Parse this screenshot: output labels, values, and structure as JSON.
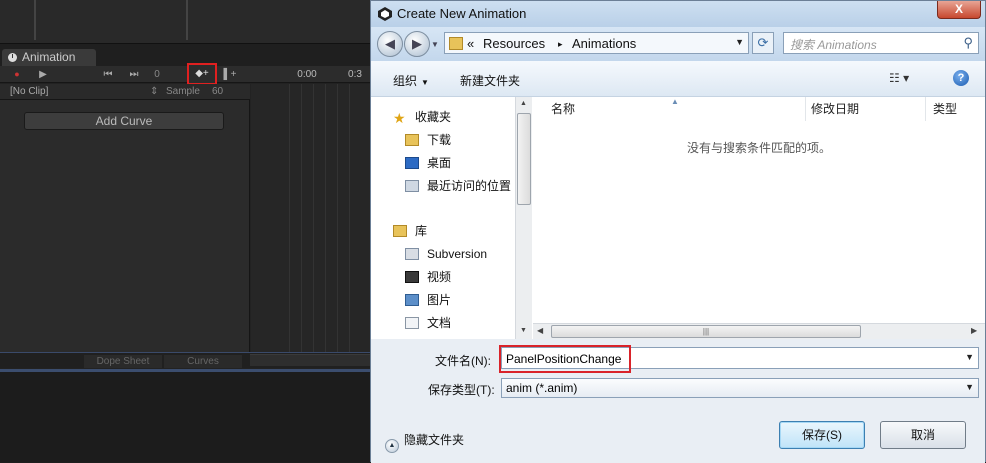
{
  "unity": {
    "tab_label": "Animation",
    "frame_value": "0",
    "time_start": "0:00",
    "time_next": "0:3",
    "clip_label": "[No Clip]",
    "clip_arrows": "⇕",
    "sample_label": "Sample",
    "sample_value": "60",
    "add_curve_label": "Add Curve",
    "dope_sheet_label": "Dope Sheet",
    "curves_label": "Curves",
    "record_glyph": "●",
    "play_glyph": "▶",
    "prev_glyph": "⏮",
    "next_glyph": "⏭",
    "add_key_glyph": "◆+",
    "add_event_glyph": "▌+"
  },
  "dialog": {
    "title": "Create New Animation",
    "close_glyph": "X",
    "address": {
      "sep": "«",
      "crumbs": [
        "Resources",
        "Animations"
      ],
      "arrow": "▸"
    },
    "search_placeholder": "搜索 Animations",
    "toolbar": {
      "organize": "组织",
      "new_folder": "新建文件夹",
      "help": "?"
    },
    "nav_items": [
      {
        "label": "收藏夹",
        "icon": "star-icon"
      },
      {
        "label": "下载",
        "icon": "download-folder-icon"
      },
      {
        "label": "桌面",
        "icon": "desktop-icon"
      },
      {
        "label": "最近访问的位置",
        "icon": "recent-places-icon"
      },
      {
        "label": "库",
        "icon": "library-icon"
      },
      {
        "label": "Subversion",
        "icon": "subversion-icon"
      },
      {
        "label": "视频",
        "icon": "video-icon"
      },
      {
        "label": "图片",
        "icon": "pictures-icon"
      },
      {
        "label": "文档",
        "icon": "documents-icon"
      }
    ],
    "columns": {
      "name": "名称",
      "modified": "修改日期",
      "type": "类型"
    },
    "empty_message": "没有与搜索条件匹配的项。",
    "filename_label": "文件名(N):",
    "filename_value": "PanelPositionChange",
    "filetype_label": "保存类型(T):",
    "filetype_value": "anim (*.anim)",
    "hide_folders": "隐藏文件夹",
    "save_label": "保存(S)",
    "cancel_label": "取消",
    "colors": {
      "highlight_red": "#d9232a",
      "dialog_frame": "#bcd3ea"
    }
  }
}
